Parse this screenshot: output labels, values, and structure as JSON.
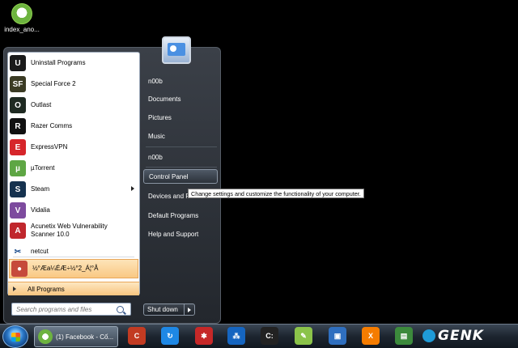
{
  "desktop": {
    "icon_label": "index_ano..."
  },
  "start_menu": {
    "programs": [
      {
        "label": "Uninstall Programs",
        "icon": "iobit-uninstaller-icon",
        "color": "#1a1a1a",
        "glyph": "U"
      },
      {
        "label": "Special Force 2",
        "icon": "special-force-icon",
        "color": "#3b3b24",
        "glyph": "SF"
      },
      {
        "label": "Outlast",
        "icon": "outlast-icon",
        "color": "#1f2a22",
        "glyph": "O"
      },
      {
        "label": "Razer Comms",
        "icon": "razer-icon",
        "color": "#111111",
        "glyph": "R"
      },
      {
        "label": "ExpressVPN",
        "icon": "expressvpn-icon",
        "color": "#d6262b",
        "glyph": "E"
      },
      {
        "label": "µTorrent",
        "icon": "utorrent-icon",
        "color": "#5ea644",
        "glyph": "µ"
      },
      {
        "label": "Steam",
        "icon": "steam-icon",
        "color": "#16324f",
        "glyph": "S"
      },
      {
        "label": "Vidalia",
        "icon": "vidalia-icon",
        "color": "#7d4b9e",
        "glyph": "V"
      },
      {
        "label": "Acunetix Web Vulnerability Scanner 10.0",
        "icon": "acunetix-icon",
        "color": "#c0272d",
        "glyph": "A"
      },
      {
        "label": "netcut",
        "icon": "scissors-icon",
        "color": "#ffffff",
        "glyph": "✂"
      },
      {
        "label": "½°Æa¼ÉÆ÷½°2_Á¦°Å",
        "icon": "app-icon",
        "color": "#c64a3b",
        "glyph": "●"
      }
    ],
    "all_programs": "All Programs",
    "search_placeholder": "Search programs and files",
    "right_items": [
      "n00b",
      "Documents",
      "Pictures",
      "Music",
      "n00b",
      "Control Panel",
      "Devices and Printers",
      "Default Programs",
      "Help and Support"
    ],
    "tooltip": "Change settings and customize the functionality of your computer.",
    "shutdown": "Shut down"
  },
  "taskbar": {
    "active_window": "(1) Facebook - Cố...",
    "brand": "GENK",
    "pinned": [
      {
        "name": "ccleaner-icon",
        "color": "#c23b22",
        "glyph": "C"
      },
      {
        "name": "speed-icon",
        "color": "#1e88e5",
        "glyph": "↻"
      },
      {
        "name": "red-app-icon",
        "color": "#c62828",
        "glyph": "✱"
      },
      {
        "name": "network-icon",
        "color": "#1565c0",
        "glyph": "⁂"
      },
      {
        "name": "cmd-icon",
        "color": "#222222",
        "glyph": "C:"
      },
      {
        "name": "notepad-icon",
        "color": "#8bc34a",
        "glyph": "✎"
      },
      {
        "name": "remote-desktop-icon",
        "color": "#2f6fbf",
        "glyph": "▣"
      },
      {
        "name": "xampp-icon",
        "color": "#f57c00",
        "glyph": "X"
      },
      {
        "name": "monitor-icon",
        "color": "#3c8a3c",
        "glyph": "▤"
      }
    ]
  }
}
